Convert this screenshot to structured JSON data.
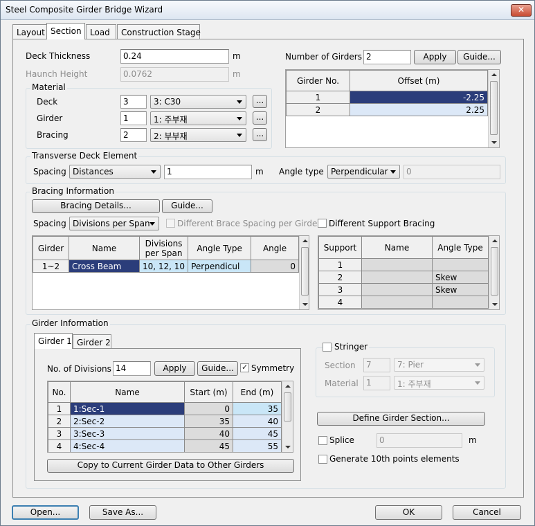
{
  "window": {
    "title": "Steel Composite Girder Bridge Wizard",
    "close_glyph": "✕"
  },
  "tabs": [
    {
      "label": "Layout"
    },
    {
      "label": "Section"
    },
    {
      "label": "Load"
    },
    {
      "label": "Construction Stage"
    }
  ],
  "deck": {
    "thickness_label": "Deck Thickness",
    "thickness_value": "0.24",
    "thickness_unit": "m",
    "haunch_label": "Haunch Height",
    "haunch_value": "0.0762",
    "haunch_unit": "m"
  },
  "material": {
    "group_label": "Material",
    "rows": [
      {
        "label": "Deck",
        "num": "3",
        "value": "3: C30",
        "more": "..."
      },
      {
        "label": "Girder",
        "num": "1",
        "value": "1: 주부재",
        "more": "..."
      },
      {
        "label": "Bracing",
        "num": "2",
        "value": "2: 부부재",
        "more": "..."
      }
    ]
  },
  "girders": {
    "label": "Number of Girders",
    "value": "2",
    "apply": "Apply",
    "guide": "Guide...",
    "headers": [
      "Girder No.",
      "Offset (m)"
    ],
    "rows": [
      {
        "no": "1",
        "offset": "-2.25"
      },
      {
        "no": "2",
        "offset": "2.25"
      }
    ]
  },
  "transverse": {
    "group_label": "Transverse Deck Element",
    "spacing_label": "Spacing",
    "spacing_mode": "Distances",
    "spacing_value": "1",
    "spacing_unit": "m",
    "angle_label": "Angle type",
    "angle_type": "Perpendicular",
    "angle_value": "0"
  },
  "bracing": {
    "group_label": "Bracing Information",
    "details_btn": "Bracing Details...",
    "guide_btn": "Guide...",
    "spacing_label": "Spacing",
    "spacing_mode": "Divisions per Span",
    "diff_brace_label": "Different Brace Spacing per Girder",
    "diff_support_label": "Different Support Bracing",
    "headers": [
      "Girder",
      "Name",
      "Divisions per Span",
      "Angle Type",
      "Angle"
    ],
    "rows": [
      {
        "girder": "1~2",
        "name": "Cross Beam",
        "divisions": "10, 12, 10",
        "angle_type": "Perpendicul",
        "angle": "0"
      }
    ],
    "support_headers": [
      "Support",
      "Name",
      "Angle Type"
    ],
    "support_rows": [
      {
        "support": "1",
        "name": "",
        "angle_type": ""
      },
      {
        "support": "2",
        "name": "",
        "angle_type": "Skew"
      },
      {
        "support": "3",
        "name": "",
        "angle_type": "Skew"
      },
      {
        "support": "4",
        "name": "",
        "angle_type": ""
      }
    ]
  },
  "girder_info": {
    "group_label": "Girder Information",
    "tabs": [
      {
        "label": "Girder 1"
      },
      {
        "label": "Girder 2"
      }
    ],
    "divisions_label": "No. of Divisions",
    "divisions_value": "14",
    "apply": "Apply",
    "guide": "Guide...",
    "symmetry_label": "Symmetry",
    "headers": [
      "No.",
      "Name",
      "Start (m)",
      "End (m)"
    ],
    "rows": [
      {
        "no": "1",
        "name": "1:Sec-1",
        "start": "0",
        "end": "35"
      },
      {
        "no": "2",
        "name": "2:Sec-2",
        "start": "35",
        "end": "40"
      },
      {
        "no": "3",
        "name": "3:Sec-3",
        "start": "40",
        "end": "45"
      },
      {
        "no": "4",
        "name": "4:Sec-4",
        "start": "45",
        "end": "55"
      }
    ],
    "copy_btn": "Copy to Current Girder Data to Other Girders"
  },
  "stringer": {
    "label": "Stringer",
    "section_label": "Section",
    "section_num": "7",
    "section_value": "7: Pier",
    "material_label": "Material",
    "material_num": "1",
    "material_value": "1: 주부재"
  },
  "define_section_btn": "Define Girder Section...",
  "splice": {
    "label": "Splice",
    "value": "0",
    "unit": "m"
  },
  "tenth_points_label": "Generate 10th points elements",
  "footer": {
    "open": "Open...",
    "save_as": "Save As...",
    "ok": "OK",
    "cancel": "Cancel"
  }
}
